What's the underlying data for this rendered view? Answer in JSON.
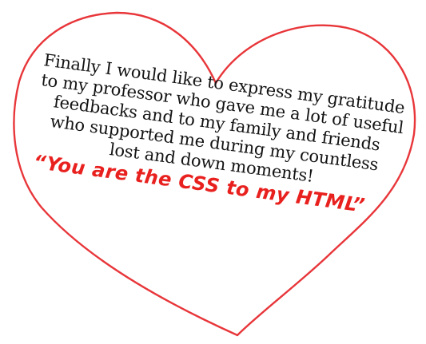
{
  "heart": {
    "stroke_color": "#e8363a"
  },
  "message": {
    "lines": [
      "Finally I would like to express my gratitude",
      "to my professor who gave me a lot of useful",
      "feedbacks and to my family and friends",
      "who supported me during my countless",
      "lost and down moments!"
    ],
    "quote": "“You are the CSS to my HTML”",
    "text_color": "#141414",
    "quote_color": "#e8211f"
  }
}
